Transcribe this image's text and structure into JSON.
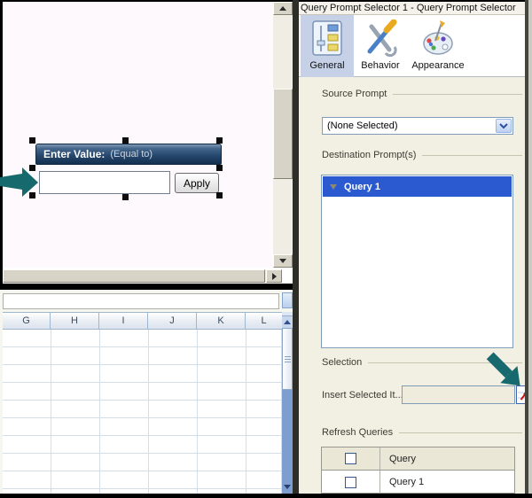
{
  "properties_panel": {
    "title": "Query Prompt Selector 1 - Query Prompt Selector",
    "tabs": [
      {
        "label": "General",
        "icon": "sliders-icon",
        "selected": true
      },
      {
        "label": "Behavior",
        "icon": "tools-icon",
        "selected": false
      },
      {
        "label": "Appearance",
        "icon": "palette-icon",
        "selected": false
      }
    ],
    "source_prompt": {
      "label": "Source Prompt",
      "selected_value": "(None Selected)"
    },
    "destination_prompts": {
      "label": "Destination Prompt(s)",
      "items": [
        {
          "label": "Query 1",
          "selected": true
        }
      ]
    },
    "selection": {
      "label": "Selection",
      "insert_label": "Insert Selected It...",
      "field_value": ""
    },
    "refresh_queries": {
      "label": "Refresh Queries",
      "column_header": "Query",
      "rows": [
        {
          "label": "Query 1",
          "checked": false
        }
      ]
    }
  },
  "canvas": {
    "prompt_component": {
      "title": "Enter Value:",
      "operator": "(Equal to)",
      "input_value": "",
      "apply_label": "Apply"
    }
  },
  "spreadsheet": {
    "columns": [
      "G",
      "H",
      "I",
      "J",
      "K",
      "L"
    ]
  },
  "annotations": {
    "arrow_color": "#16696d",
    "targets": [
      "value-input",
      "cell-selector-button"
    ]
  },
  "colors": {
    "selection_blue": "#2b59cf",
    "component_header_navy": "#1d3a5c",
    "panel_beige": "#f2efe3",
    "tab_selected_blue": "#c6d1e8",
    "excel_scroll_track": "#7e9ecf"
  }
}
